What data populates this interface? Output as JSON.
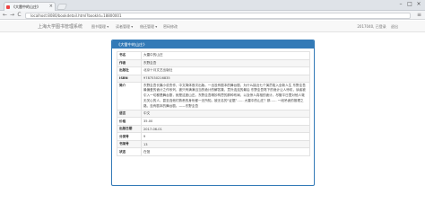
{
  "browser": {
    "tab_title": "《大雷中的山庄》",
    "tab_close": "×",
    "url": "localhost:8080/bookdetail.html?bookId=18800001",
    "back": "←",
    "forward": "→",
    "reload": "C",
    "menu": "≡",
    "minimize": "–",
    "maximize": "□",
    "close": "×"
  },
  "navbar": {
    "brand": "上海大学图书管理系统",
    "items": [
      "图书管理 ▾",
      "读者管理 ▾",
      "借还管理 ▾",
      "密码修改"
    ],
    "user": "2017040, 已登录",
    "logout": "退出"
  },
  "panel": {
    "title": "《大雷中的山庄》"
  },
  "detail": {
    "rows": [
      {
        "label": "书名",
        "value": "大雷中的山庄"
      },
      {
        "label": "作者",
        "value": "东野圭吾"
      },
      {
        "label": "出版社",
        "value": "北京十月文艺出版社"
      },
      {
        "label": "ISBN",
        "value": "9787530216835"
      },
      {
        "label": "简介",
        "value": "东野圭吾长篇小说杰作，中文简体首次出版。一出没有剧本的舞台剧，为什么接近七个演员陷入全新人生 东野圭吾最偏爱的诡计之作系列，被只有满满当当的诡计的解答集，意外连连的最后 东野圭吾笔下的诡计让人惊叹，读者被引入一切都是舞台剧，就是这座山庄。东野圭吾精妙构思的那种布局，以及惊人真相的诡计。尽管平日里对他人毫无关心的人，甚至连他们熟悉的身份都一无所知。被无名的“证据”…… 大雷中的山庄？那…… 一段吊诡的推理之路，没有剧本的舞台剧。——东野圭吾"
      },
      {
        "label": "语言",
        "value": "中文"
      },
      {
        "label": "价格",
        "value": "35.00"
      },
      {
        "label": "出版日期",
        "value": "2017-06-01"
      },
      {
        "label": "分类号",
        "value": "9"
      },
      {
        "label": "书架号",
        "value": "13"
      },
      {
        "label": "状态",
        "value": "在馆"
      }
    ]
  }
}
